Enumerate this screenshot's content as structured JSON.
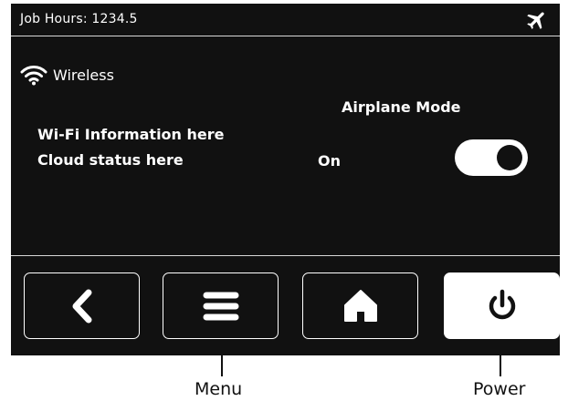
{
  "status_bar": {
    "job_hours": "Job Hours: 1234.5",
    "status_icon": "airplane-icon"
  },
  "wireless": {
    "title": "Wireless",
    "icon": "wifi-icon",
    "wifi_info": "Wi-Fi Information here",
    "cloud_status": "Cloud status here"
  },
  "airplane_mode": {
    "label": "Airplane Mode",
    "state_text": "On",
    "enabled": true
  },
  "nav": {
    "buttons": [
      {
        "icon": "back-chevron-icon"
      },
      {
        "icon": "menu-icon"
      },
      {
        "icon": "home-icon"
      },
      {
        "icon": "power-icon",
        "active": true
      }
    ]
  },
  "callouts": {
    "menu": "Menu",
    "power": "Power"
  },
  "colors": {
    "screen_background": "#111111",
    "foreground": "#ffffff",
    "divider": "#d8d8d8"
  }
}
